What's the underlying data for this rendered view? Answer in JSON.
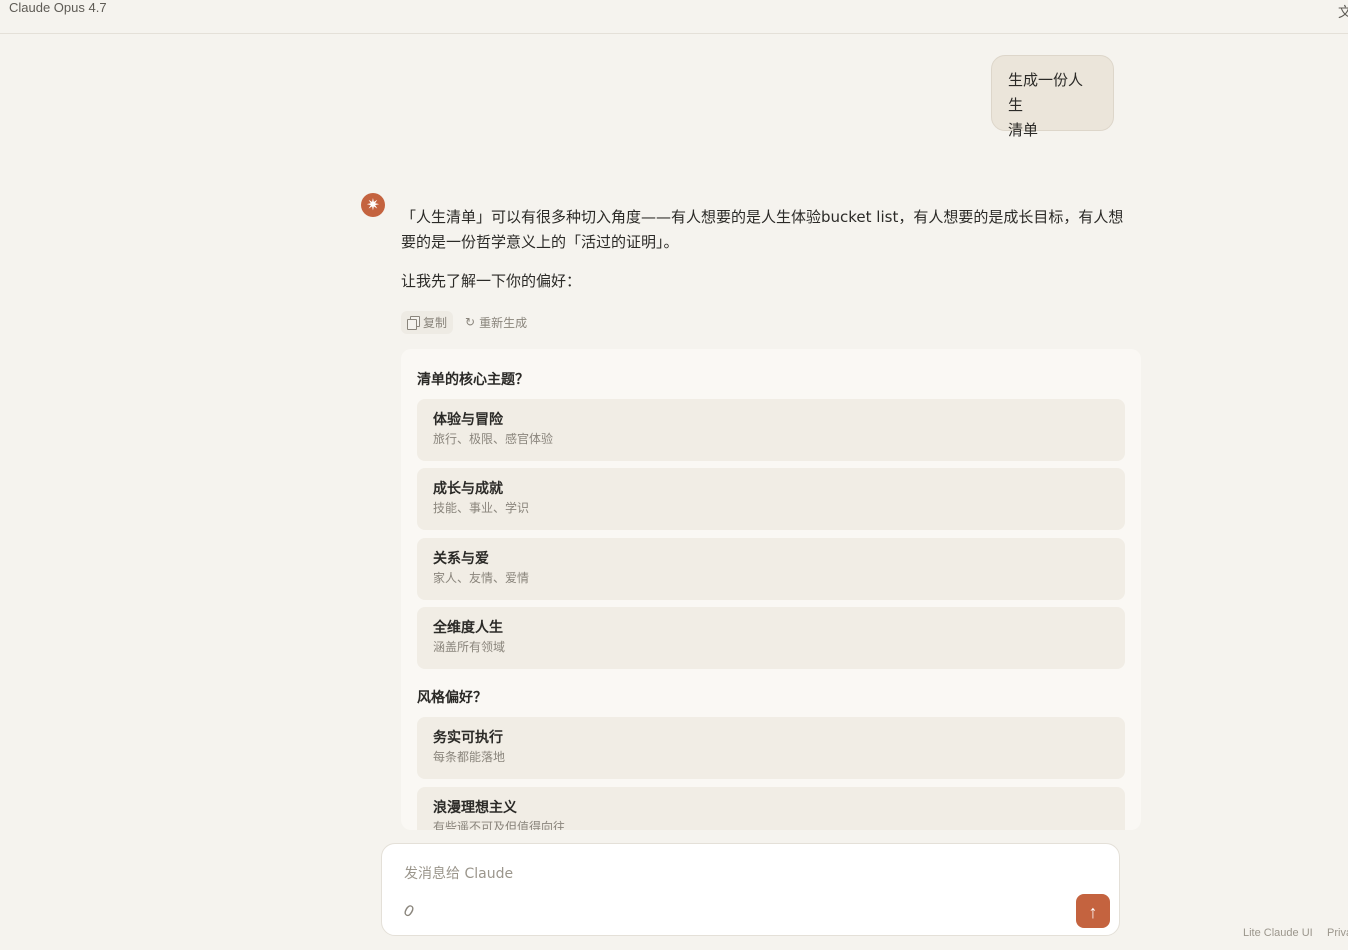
{
  "app": {
    "title": "Claude Opus 4.7",
    "lang_icon": "文"
  },
  "user_message": {
    "text_line1": "生成一份人生",
    "text_line2": "清单"
  },
  "assistant": {
    "avatar": "✷",
    "paragraph1": "「人生清单」可以有很多种切入角度——有人想要的是人生体验bucket list，有人想要的是成长目标，有人想要的是一份哲学意义上的「活过的证明」。",
    "paragraph2": "让我先了解一下你的偏好：",
    "actions": {
      "copy": "复制",
      "regenerate": "重新生成",
      "regenerate_icon": "↻"
    }
  },
  "questions": [
    {
      "title": "清单的核心主题？",
      "options": [
        {
          "label": "体验与冒险",
          "desc": "旅行、极限、感官体验"
        },
        {
          "label": "成长与成就",
          "desc": "技能、事业、学识"
        },
        {
          "label": "关系与爱",
          "desc": "家人、友情、爱情"
        },
        {
          "label": "全维度人生",
          "desc": "涵盖所有领域"
        }
      ]
    },
    {
      "title": "风格偏好？",
      "options": [
        {
          "label": "务实可执行",
          "desc": "每条都能落地"
        },
        {
          "label": "浪漫理想主义",
          "desc": "有些遥不可及但值得向往"
        }
      ]
    }
  ],
  "composer": {
    "placeholder": "发消息给 Claude",
    "value": "",
    "attach_icon": "paperclip-icon",
    "send_icon": "↑"
  },
  "footer": {
    "brand": "Lite Claude UI",
    "privacy": "Priva"
  },
  "colors": {
    "accent": "#c4633f",
    "background": "#f5f3ee"
  }
}
